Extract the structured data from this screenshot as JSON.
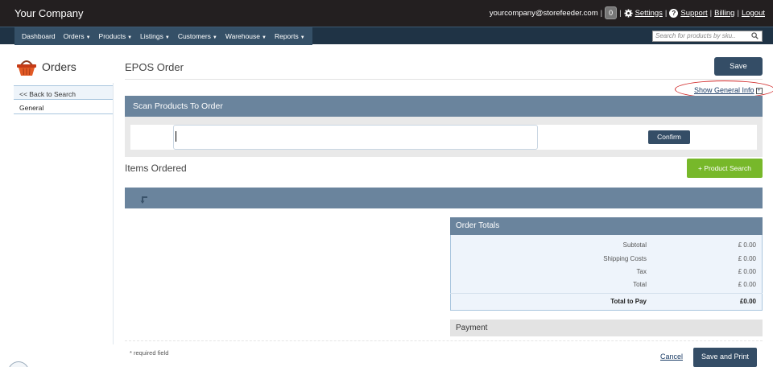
{
  "brand": "Your Company",
  "user": {
    "email": "yourcompany@storefeeder.com",
    "badge_count": "0",
    "settings": "Settings",
    "support": "Support",
    "billing": "Billing",
    "logout": "Logout",
    "sep": "|"
  },
  "nav": {
    "items": [
      "Dashboard",
      "Orders",
      "Products",
      "Listings",
      "Customers",
      "Warehouse",
      "Reports"
    ],
    "caret": "▼",
    "search_placeholder": "Search for products by sku.."
  },
  "sidebar": {
    "title": "Orders",
    "back": "<< Back to Search",
    "general": "General"
  },
  "main": {
    "title": "EPOS Order",
    "save": "Save",
    "show_general": "Show General Info",
    "plus": "+",
    "scan_title": "Scan Products To Order",
    "confirm": "Confirm",
    "items_title": "Items Ordered",
    "product_search": "+  Product Search"
  },
  "totals": {
    "title": "Order Totals",
    "rows": [
      {
        "label": "Subtotal",
        "value": "£ 0.00"
      },
      {
        "label": "Shipping Costs",
        "value": "£ 0.00"
      },
      {
        "label": "Tax",
        "value": "£ 0.00"
      },
      {
        "label": "Total",
        "value": "£ 0.00"
      }
    ],
    "total_to_pay_label": "Total to Pay",
    "total_to_pay_value": "£0.00"
  },
  "payment": {
    "title": "Payment"
  },
  "footer": {
    "required": "* required field",
    "cancel": "Cancel",
    "save_print": "Save and Print"
  },
  "colors": {
    "topbar": "#231f20",
    "nav": "#355067",
    "panel": "#6a849d",
    "button": "#344d66",
    "green_button": "#77b82a",
    "highlight_ellipse": "#d12a2a"
  }
}
